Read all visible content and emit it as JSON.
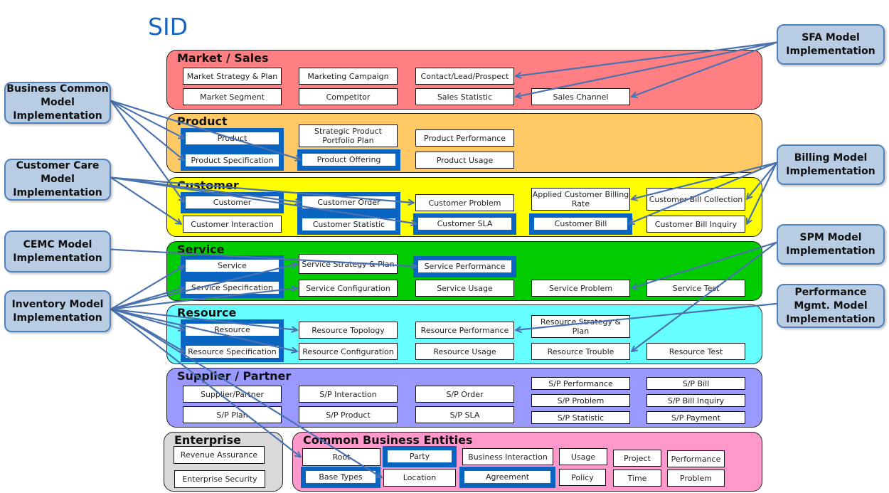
{
  "title": "SID",
  "colors": {
    "market_sales": "#ff7f82",
    "product": "#ffc966",
    "customer": "#ffff00",
    "service": "#00cc00",
    "resource": "#66ffff",
    "supplier_partner": "#9999ff",
    "enterprise": "#d9d9d9",
    "common_business": "#ff99cc",
    "highlight": "#0a64c2",
    "model_fill": "#b8cce4",
    "model_border": "#4f81bd",
    "arrow": "#4a72b0"
  },
  "domains": {
    "market_sales": {
      "label": "Market / Sales",
      "entities": [
        "Market Strategy & Plan",
        "Marketing Campaign",
        "Contact/Lead/Prospect",
        "Market Segment",
        "Competitor",
        "Sales Statistic",
        "Sales Channel"
      ]
    },
    "product": {
      "label": "Product",
      "entities": [
        "Product",
        "Strategic Product Portfolio Plan",
        "Product Performance",
        "Product Specification",
        "Product Offering",
        "Product Usage"
      ]
    },
    "customer": {
      "label": "Customer",
      "entities": [
        "Customer",
        "Customer Order",
        "Customer Problem",
        "Applied Customer Billing Rate",
        "Customer Bill Collection",
        "Customer Interaction",
        "Customer Statistic",
        "Customer SLA",
        "Customer Bill",
        "Customer Bill  Inquiry"
      ]
    },
    "service": {
      "label": "Service",
      "entities": [
        "Service",
        "Service Strategy & Plan",
        "Service Performance",
        "Service Specification",
        "Service Configuration",
        "Service Usage",
        "Service Problem",
        "Service Test"
      ]
    },
    "resource": {
      "label": "Resource",
      "entities": [
        "Resource",
        "Resource Topology",
        "Resource Performance",
        "Resource Strategy & Plan",
        "Resource Specification",
        "Resource Configuration",
        "Resource Usage",
        "Resource Trouble",
        "Resource Test"
      ]
    },
    "supplier_partner": {
      "label": "Supplier / Partner",
      "entities": [
        "Supplier/Partner",
        "S/P Interaction",
        "S/P Order",
        "S/P Performance",
        "S/P Bill",
        "S/P Problem",
        "S/P Bill Inquiry",
        "S/P Plan",
        "S/P Product",
        "S/P SLA",
        "S/P Statistic",
        "S/P Payment"
      ]
    },
    "enterprise": {
      "label": "Enterprise",
      "entities": [
        "Revenue Assurance",
        "Enterprise Security"
      ]
    },
    "common_business": {
      "label": "Common Business Entities",
      "entities": [
        "Root",
        "Party",
        "Business Interaction",
        "Usage",
        "Project",
        "Performance",
        "Base Types",
        "Location",
        "Agreement",
        "Policy",
        "Time",
        "Problem"
      ]
    }
  },
  "models": {
    "business_common": "Business Common Model Implementation",
    "customer_care": "Customer Care Model Implementation",
    "cemc": "CEMC Model Implementation",
    "inventory": "Inventory Model Implementation",
    "sfa": "SFA Model Implementation",
    "billing": "Billing Model Implementation",
    "spm": "SPM Model Implementation",
    "performance_mgmt": "Performance Mgmt. Model Implementation"
  },
  "model_lines": {
    "business_common": [
      "Model",
      "Implementation",
      "Business Common"
    ],
    "customer_care": [
      "Customer Care",
      "Model",
      "Implementation"
    ],
    "cemc": [
      "CEMC",
      "Model",
      "Implementation"
    ],
    "inventory": [
      "Inventory",
      "Model",
      "Implementation"
    ],
    "sfa": [
      "SFA Model",
      "Implementation"
    ],
    "billing": [
      "Billing Model",
      "Implementation"
    ],
    "spm": [
      "SPM Model",
      "Implementation"
    ],
    "performance_mgmt": [
      "Performance",
      "Mgmt. Model",
      "Implementation"
    ]
  },
  "mappings": [
    {
      "model": "sfa",
      "targets": [
        "Contact/Lead/Prospect",
        "Sales Statistic",
        "Sales Channel"
      ]
    },
    {
      "model": "business_common",
      "targets": [
        "Product",
        "Product Specification",
        "Product Offering",
        "Customer"
      ]
    },
    {
      "model": "customer_care",
      "targets": [
        "Customer Interaction",
        "Customer Order",
        "Customer Problem",
        "Customer SLA"
      ]
    },
    {
      "model": "billing",
      "targets": [
        "Applied Customer Billing Rate",
        "Customer Bill Collection",
        "Customer Bill",
        "Customer Bill  Inquiry"
      ]
    },
    {
      "model": "cemc",
      "targets": [
        "Service Performance"
      ]
    },
    {
      "model": "spm",
      "targets": [
        "Service Problem",
        "Resource Trouble"
      ]
    },
    {
      "model": "inventory",
      "targets": [
        "Service",
        "Service Specification",
        "Service Strategy & Plan",
        "Service Configuration",
        "Resource",
        "Resource Specification",
        "Resource Topology",
        "Resource Configuration",
        "Root",
        "Location"
      ]
    },
    {
      "model": "performance_mgmt",
      "targets": [
        "Resource Performance"
      ]
    }
  ]
}
